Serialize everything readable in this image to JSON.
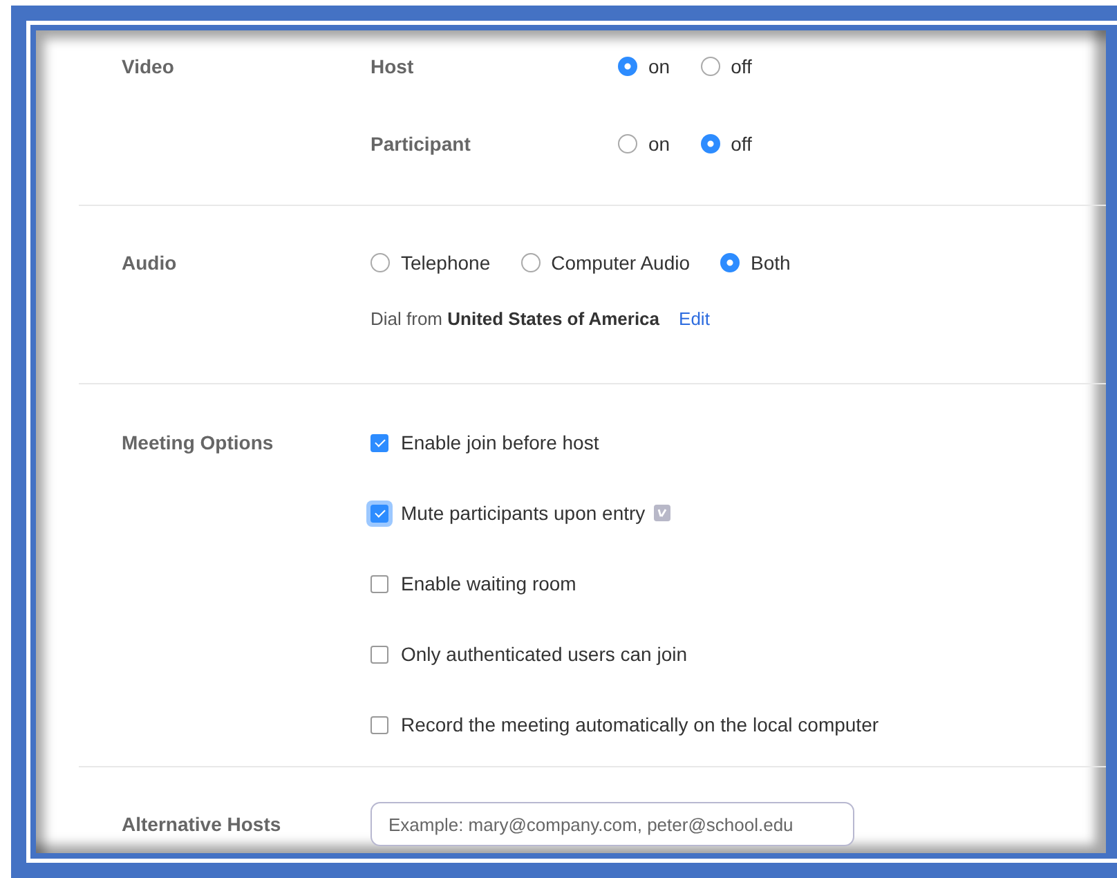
{
  "sections": [
    {
      "label": "Video",
      "rows": [
        {
          "kind": "radios",
          "label": "Host",
          "options": [
            {
              "label": "on",
              "selected": true
            },
            {
              "label": "off",
              "selected": false
            }
          ]
        },
        {
          "kind": "radios",
          "label": "Participant",
          "options": [
            {
              "label": "on",
              "selected": false
            },
            {
              "label": "off",
              "selected": true
            }
          ]
        }
      ]
    },
    {
      "label": "Audio",
      "rows": [
        {
          "kind": "radios",
          "options": [
            {
              "label": "Telephone",
              "selected": false
            },
            {
              "label": "Computer Audio",
              "selected": false
            },
            {
              "label": "Both",
              "selected": true
            }
          ]
        },
        {
          "kind": "dial",
          "text": "Dial from **United States of America**",
          "link": "Edit"
        }
      ]
    },
    {
      "label": "Meeting Options",
      "rows": [
        {
          "kind": "checkbox",
          "label": "Enable join before host",
          "checked": true,
          "focused": false
        },
        {
          "kind": "checkbox",
          "label": "Mute participants upon entry",
          "checked": true,
          "focused": true,
          "info_icon": true
        },
        {
          "kind": "checkbox",
          "label": "Enable waiting room",
          "checked": false,
          "focused": false
        },
        {
          "kind": "checkbox",
          "label": "Only authenticated users can join",
          "checked": false,
          "focused": false
        },
        {
          "kind": "checkbox",
          "label": "Record the meeting automatically on the local computer",
          "checked": false,
          "focused": false
        }
      ]
    },
    {
      "label": "Alternative Hosts",
      "rows": [
        {
          "kind": "input",
          "placeholder": "Example: mary@company.com, peter@school.edu"
        }
      ]
    }
  ]
}
